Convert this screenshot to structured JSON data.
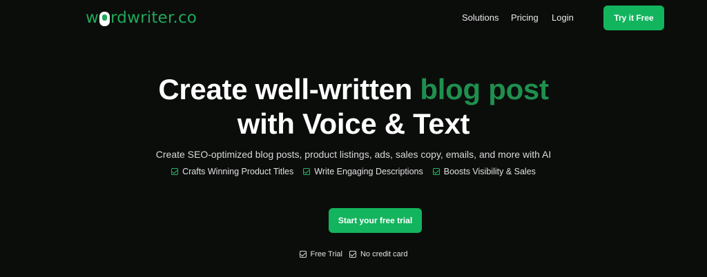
{
  "header": {
    "logo_prefix": "w",
    "logo_suffix": "rdwriter.co",
    "menu": [
      {
        "label": "Solutions"
      },
      {
        "label": "Pricing"
      },
      {
        "label": "Login"
      }
    ],
    "cta_label": "Try it Free"
  },
  "hero": {
    "headline_line1_white": "Create well-written ",
    "headline_line1_green": "blog post",
    "headline_line2": "with Voice & Text",
    "subtitle": "Create SEO-optimized blog posts, product listings, ads, sales copy, emails, and more with AI",
    "features": [
      {
        "label": "Crafts Winning Product Titles"
      },
      {
        "label": "Write Engaging Descriptions"
      },
      {
        "label": "Boosts Visibility & Sales"
      }
    ],
    "cta_label": "Start your free trial",
    "badges": [
      {
        "label": "Free Trial"
      },
      {
        "label": "No credit card"
      }
    ]
  },
  "colors": {
    "background": "#0b0d0b",
    "accent": "#13b45e",
    "headline_green": "#1f8f4e"
  },
  "icons": [
    "microphone-logo-icon",
    "checkbox-icon"
  ]
}
